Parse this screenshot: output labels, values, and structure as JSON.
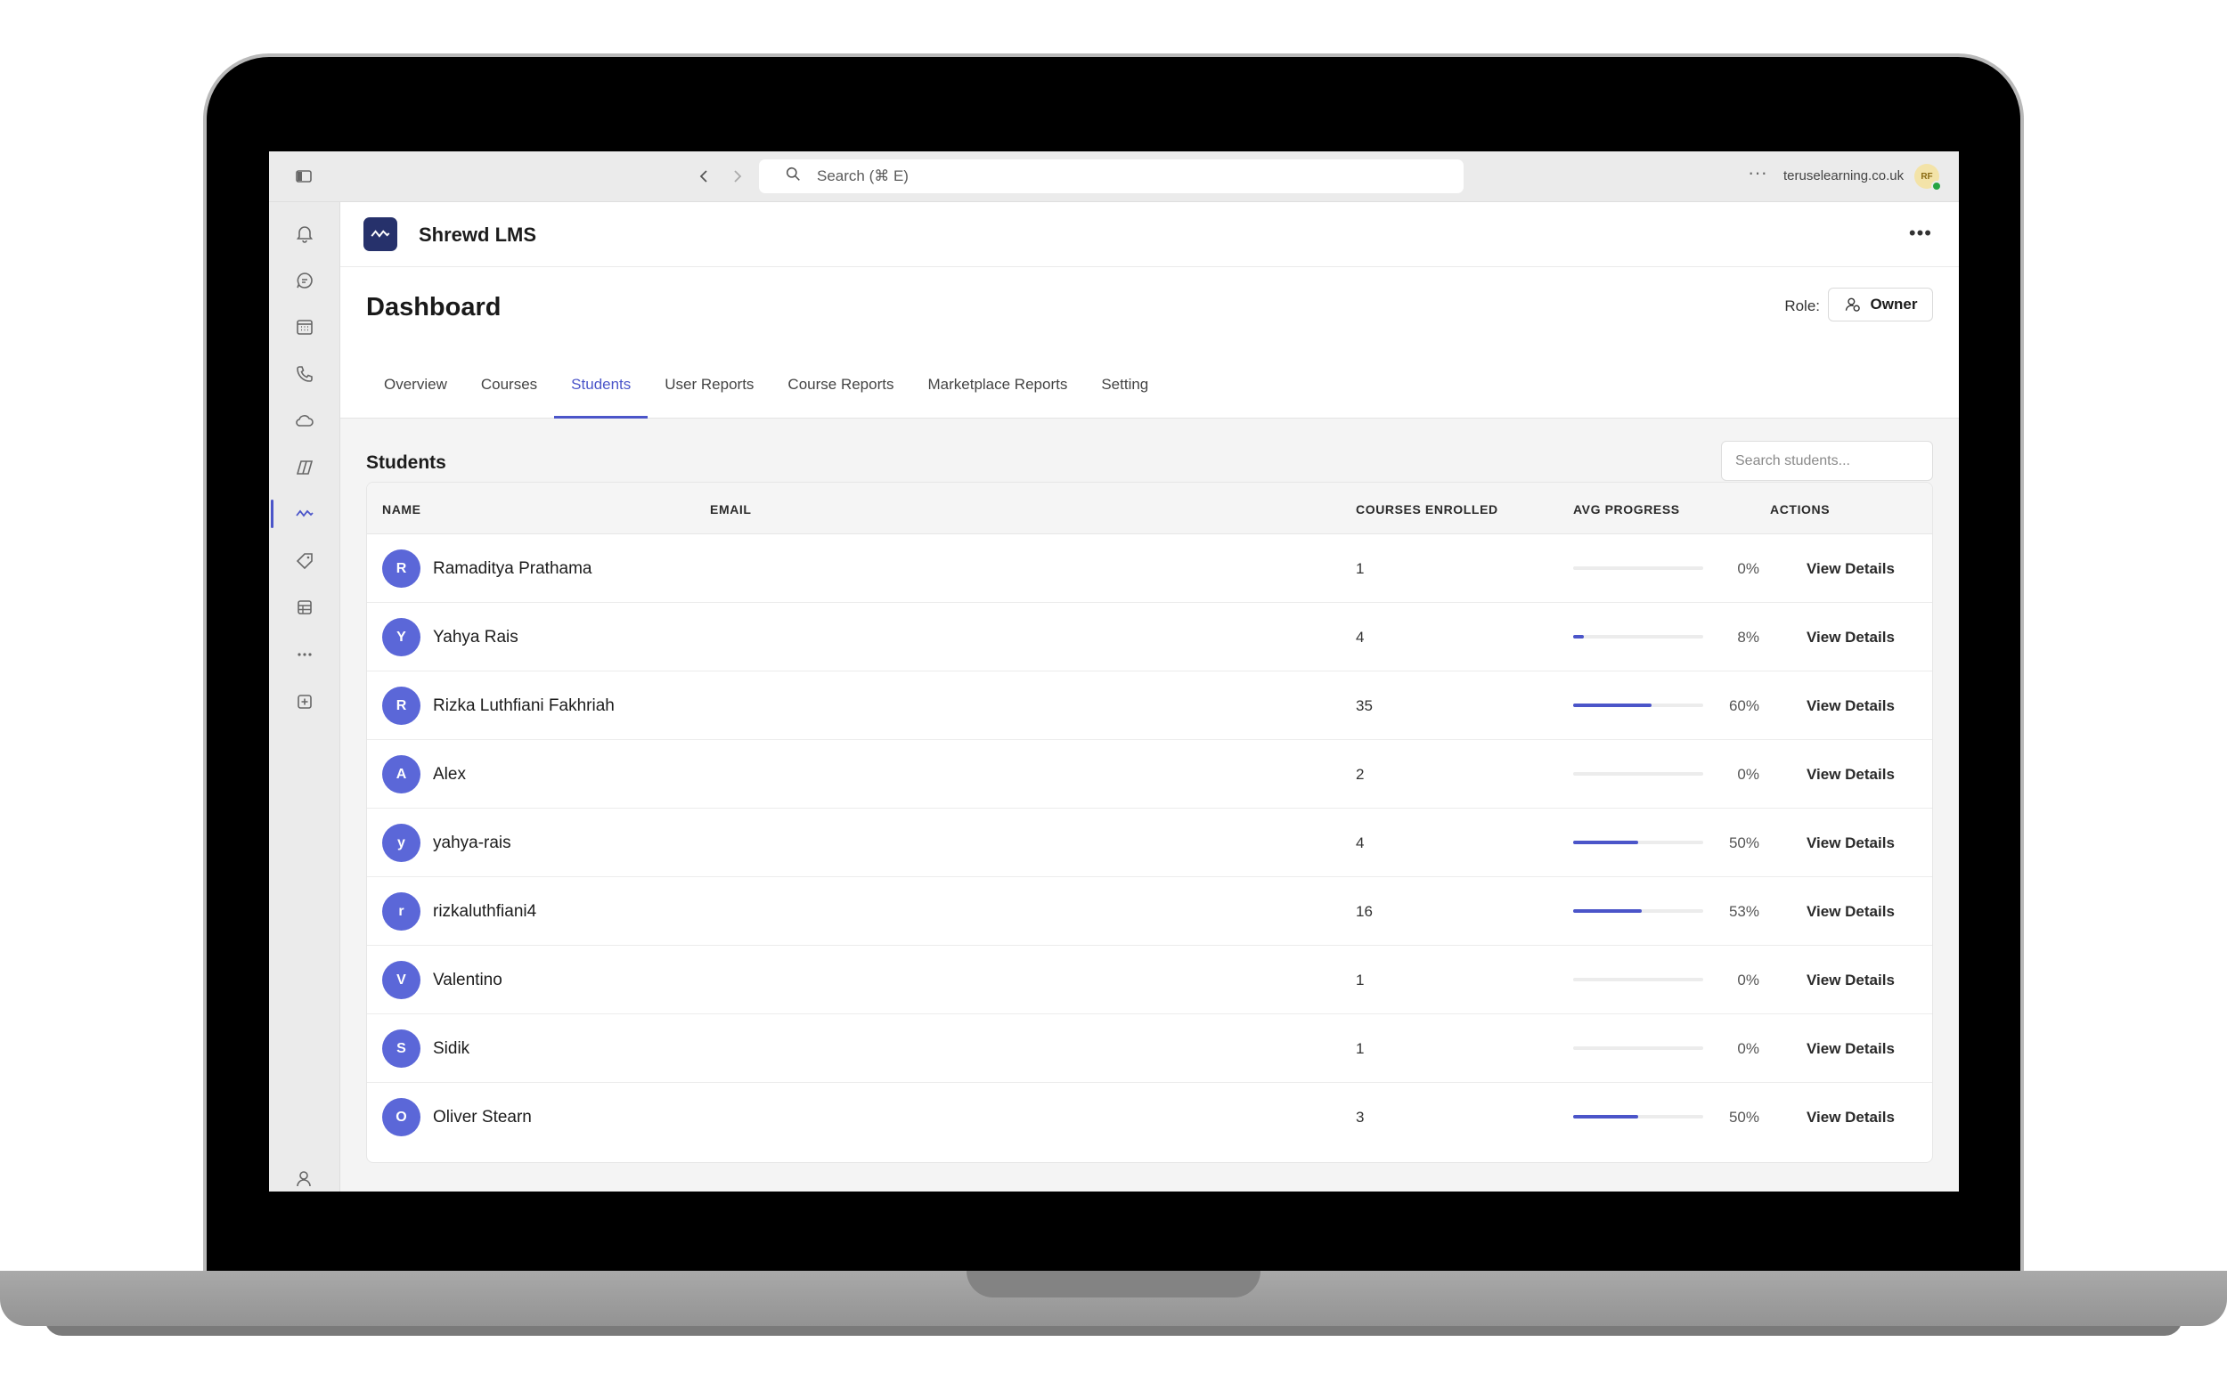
{
  "browser": {
    "search_placeholder": "Search (⌘ E)",
    "domain": "teruselearning.co.uk",
    "avatar_initials": "RF"
  },
  "app": {
    "name": "Shrewd LMS",
    "page_title": "Dashboard",
    "role_label": "Role:",
    "role_value": "Owner",
    "tabs": [
      {
        "label": "Overview",
        "active": false
      },
      {
        "label": "Courses",
        "active": false
      },
      {
        "label": "Students",
        "active": true
      },
      {
        "label": "User Reports",
        "active": false
      },
      {
        "label": "Course Reports",
        "active": false
      },
      {
        "label": "Marketplace Reports",
        "active": false
      },
      {
        "label": "Setting",
        "active": false
      }
    ]
  },
  "students": {
    "title": "Students",
    "search_placeholder": "Search students...",
    "columns": {
      "name": "NAME",
      "email": "EMAIL",
      "courses": "COURSES ENROLLED",
      "progress": "AVG PROGRESS",
      "actions": "ACTIONS"
    },
    "rows": [
      {
        "initial": "R",
        "name": "Ramaditya Prathama",
        "courses": "1",
        "progress": 0,
        "progress_label": "0%",
        "action": "View Details"
      },
      {
        "initial": "Y",
        "name": "Yahya Rais",
        "courses": "4",
        "progress": 8,
        "progress_label": "8%",
        "action": "View Details"
      },
      {
        "initial": "R",
        "name": "Rizka Luthfiani Fakhriah",
        "courses": "35",
        "progress": 60,
        "progress_label": "60%",
        "action": "View Details"
      },
      {
        "initial": "A",
        "name": "Alex",
        "courses": "2",
        "progress": 0,
        "progress_label": "0%",
        "action": "View Details"
      },
      {
        "initial": "y",
        "name": "yahya-rais",
        "courses": "4",
        "progress": 50,
        "progress_label": "50%",
        "action": "View Details"
      },
      {
        "initial": "r",
        "name": "rizkaluthfiani4",
        "courses": "16",
        "progress": 53,
        "progress_label": "53%",
        "action": "View Details"
      },
      {
        "initial": "V",
        "name": "Valentino",
        "courses": "1",
        "progress": 0,
        "progress_label": "0%",
        "action": "View Details"
      },
      {
        "initial": "S",
        "name": "Sidik",
        "courses": "1",
        "progress": 0,
        "progress_label": "0%",
        "action": "View Details"
      },
      {
        "initial": "O",
        "name": "Oliver Stearn",
        "courses": "3",
        "progress": 50,
        "progress_label": "50%",
        "action": "View Details"
      }
    ]
  },
  "colors": {
    "accent": "#4b55c9",
    "avatar": "#5b67d8",
    "logo_bg": "#26316b"
  },
  "rail_icons": [
    "bell-icon",
    "chat-icon",
    "calendar-icon",
    "phone-icon",
    "cloud-icon",
    "copilot-icon",
    "activity-icon",
    "tag-icon",
    "table-icon",
    "more-icon",
    "add-app-icon"
  ]
}
